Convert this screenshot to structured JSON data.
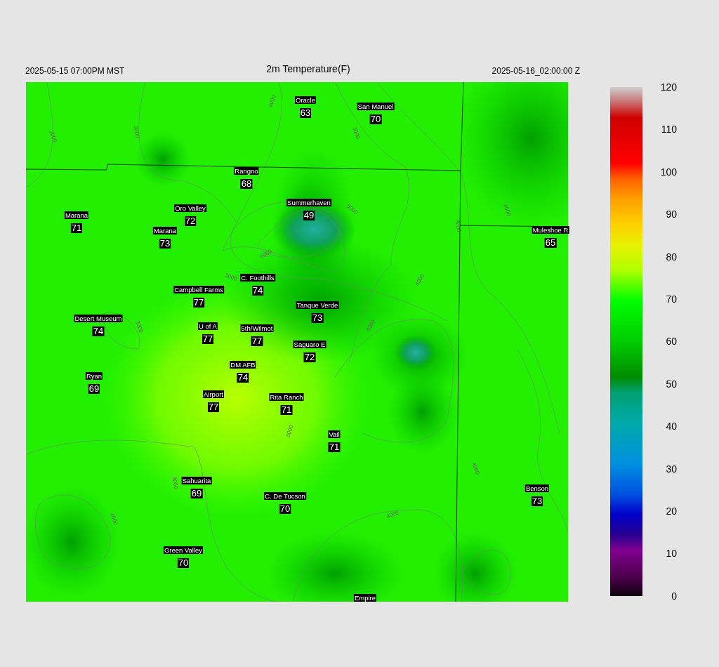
{
  "header": {
    "left": "2025-05-15 07:00PM MST",
    "title": "2m Temperature(F)",
    "right": "2025-05-16_02:00:00 Z"
  },
  "stations": [
    {
      "name": "Oracle",
      "value": "63"
    },
    {
      "name": "San Manuel",
      "value": "70"
    },
    {
      "name": "Rangno",
      "value": "68"
    },
    {
      "name": "Summerhaven",
      "value": "49"
    },
    {
      "name": "Marana",
      "value": "71"
    },
    {
      "name": "Oro Valley",
      "value": "72"
    },
    {
      "name": "Marana",
      "value": "73"
    },
    {
      "name": "Muleshoe R",
      "value": "65"
    },
    {
      "name": "C. Foothills",
      "value": "74"
    },
    {
      "name": "Campbell Farms",
      "value": "77"
    },
    {
      "name": "Tanque Verde",
      "value": "73"
    },
    {
      "name": "Desert Museum",
      "value": "74"
    },
    {
      "name": "U of A",
      "value": "77"
    },
    {
      "name": "5th/Wilmot",
      "value": "77"
    },
    {
      "name": "Saguaro E",
      "value": "72"
    },
    {
      "name": "DM AFB",
      "value": "74"
    },
    {
      "name": "Ryan",
      "value": "69"
    },
    {
      "name": "Airport",
      "value": "77"
    },
    {
      "name": "Rita Ranch",
      "value": "71"
    },
    {
      "name": "Vail",
      "value": "71"
    },
    {
      "name": "Sahuarita",
      "value": "69"
    },
    {
      "name": "C. De Tucson",
      "value": "70"
    },
    {
      "name": "Benson",
      "value": "73"
    },
    {
      "name": "Green Valley",
      "value": "70"
    },
    {
      "name": "Empire"
    }
  ],
  "contour_labels": [
    "2000",
    "3000",
    "4000",
    "3000",
    "3000",
    "4000",
    "5000",
    "3000",
    "6000",
    "3000",
    "4000",
    "4000",
    "3000",
    "3000",
    "4000",
    "4000",
    "4000"
  ],
  "colorbar": {
    "ticks": [
      "120",
      "110",
      "100",
      "90",
      "80",
      "70",
      "60",
      "50",
      "40",
      "30",
      "20",
      "10",
      "0"
    ]
  }
}
